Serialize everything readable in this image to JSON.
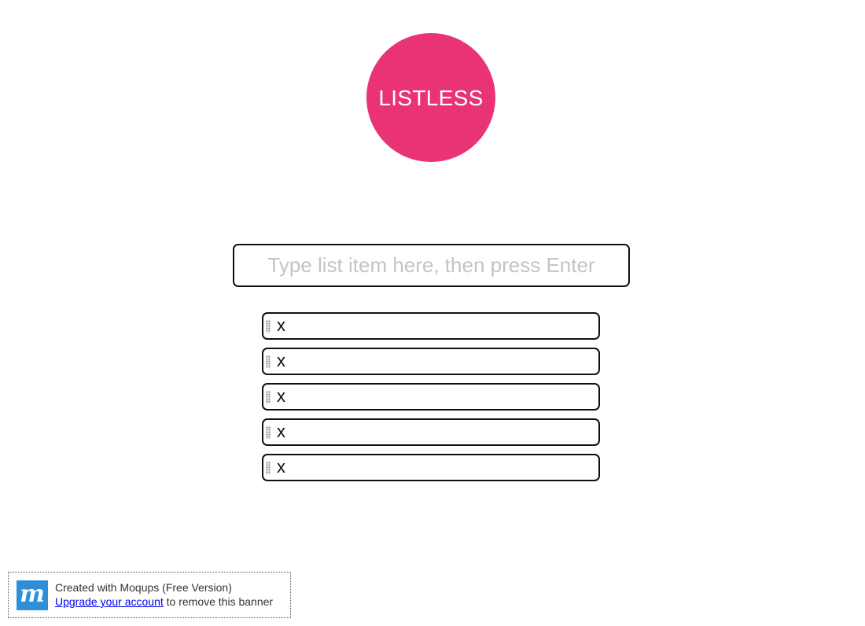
{
  "logo": {
    "text": "LISTLESS",
    "color": "#ea3375"
  },
  "entry": {
    "placeholder": "Type list item here, then press Enter",
    "value": ""
  },
  "list": {
    "items": [
      {
        "delete_label": "x",
        "handle_icon": "drag-handle-icon"
      },
      {
        "delete_label": "x",
        "handle_icon": "drag-handle-icon"
      },
      {
        "delete_label": "x",
        "handle_icon": "drag-handle-icon"
      },
      {
        "delete_label": "x",
        "handle_icon": "drag-handle-icon"
      },
      {
        "delete_label": "x",
        "handle_icon": "drag-handle-icon"
      }
    ]
  },
  "banner": {
    "logo_letter": "m",
    "logo_color": "#2d8fd9",
    "line1": "Created with Moqups (Free Version)",
    "link_text": "Upgrade your account",
    "line2_rest": " to remove this banner"
  }
}
